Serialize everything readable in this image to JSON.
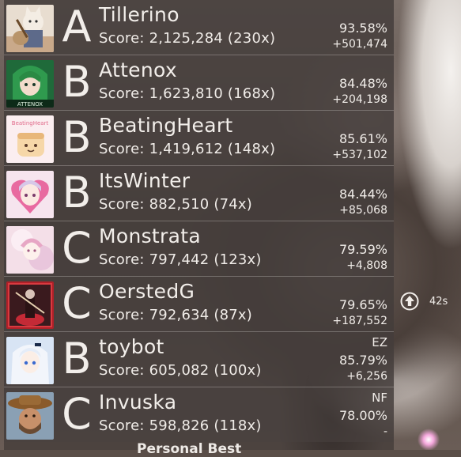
{
  "leaderboard": {
    "entries": [
      {
        "name": "Tillerino",
        "score": "Score: 2,125,284 (230x)",
        "grade": "A",
        "accuracy": "93.58%",
        "score_gap": "+501,474",
        "mods": "",
        "avatar": "anime-cat-banjo-avatar"
      },
      {
        "name": "Attenox",
        "score": "Score: 1,623,810 (168x)",
        "grade": "B",
        "accuracy": "84.48%",
        "score_gap": "+204,198",
        "mods": "",
        "avatar": "green-hair-anime-avatar",
        "avatar_text": "ATTENOX"
      },
      {
        "name": "BeatingHeart",
        "score": "Score: 1,419,612 (148x)",
        "grade": "B",
        "accuracy": "85.61%",
        "score_gap": "+537,102",
        "mods": "",
        "avatar": "toast-character-avatar",
        "avatar_text": "BeatingHeart"
      },
      {
        "name": "ItsWinter",
        "score": "Score: 882,510 (74x)",
        "grade": "B",
        "accuracy": "84.44%",
        "score_gap": "+85,068",
        "mods": "",
        "avatar": "pink-heart-anime-avatar"
      },
      {
        "name": "Monstrata",
        "score": "Score: 797,442 (123x)",
        "grade": "C",
        "accuracy": "79.59%",
        "score_gap": "+4,808",
        "mods": "",
        "avatar": "pastel-anime-avatar"
      },
      {
        "name": "OerstedG",
        "score": "Score: 792,634 (87x)",
        "grade": "C",
        "accuracy": "79.65%",
        "score_gap": "+187,552",
        "mods": "",
        "avatar": "dark-red-violin-avatar"
      },
      {
        "name": "toybot",
        "score": "Score: 605,082 (100x)",
        "grade": "B",
        "accuracy": "85.79%",
        "score_gap": "+6,256",
        "mods": "EZ",
        "avatar": "white-hair-anime-avatar"
      },
      {
        "name": "Invuska",
        "score": "Score: 598,826 (118x)",
        "grade": "C",
        "accuracy": "78.00%",
        "score_gap": "-",
        "mods": "NF",
        "avatar": "cowboy-avatar"
      }
    ],
    "footer_label": "Personal Best"
  },
  "rank_change": {
    "icon": "up-arrow-icon",
    "value": "42s"
  },
  "colors": {
    "text": "#f2eeea",
    "panel": "#3a3432"
  }
}
